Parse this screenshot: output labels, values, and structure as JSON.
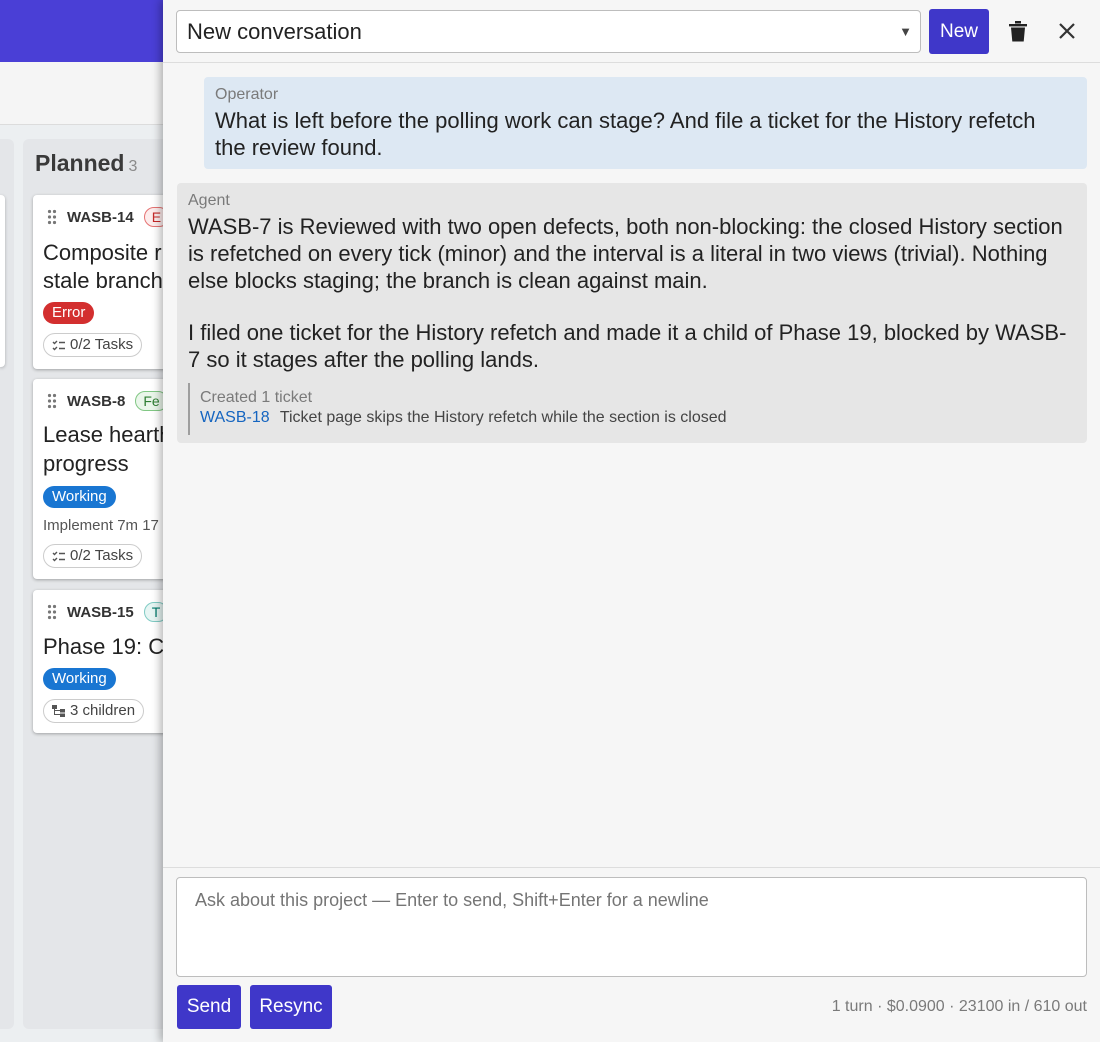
{
  "board": {
    "column": {
      "title": "Planned",
      "count": "3"
    },
    "cards": [
      {
        "id": "WASB-14",
        "tag": "E",
        "title_lines": [
          "Composite r",
          "stale branch"
        ],
        "status": "Error",
        "chip": "0/2 Tasks"
      },
      {
        "id": "WASB-8",
        "tag": "Fe",
        "title_lines": [
          "Lease hearth",
          "progress"
        ],
        "status": "Working",
        "meta": "Implement  7m 17",
        "chip": "0/2 Tasks"
      },
      {
        "id": "WASB-15",
        "tag": "T",
        "title_lines": [
          "Phase 19: Co"
        ],
        "status": "Working",
        "chip": "3 children"
      }
    ]
  },
  "drawer": {
    "conversation_select": "New conversation",
    "new_label": "New",
    "messages": {
      "user": {
        "label": "Operator",
        "text": "What is left before the polling work can stage? And file a ticket for the History refetch the review found."
      },
      "agent": {
        "label": "Agent",
        "paragraph1": "WASB-7 is Reviewed with two open defects, both non-blocking: the closed History section is refetched on every tick (minor) and the interval is a literal in two views (trivial). Nothing else blocks staging; the branch is clean against main.",
        "paragraph2": "I filed one ticket for the History refetch and made it a child of Phase 19, blocked by WASB-7 so it stages after the polling lands.",
        "attachment": {
          "label": "Created 1 ticket",
          "ticket_id": "WASB-18",
          "ticket_title": "Ticket page skips the History refetch while the section is closed"
        }
      }
    },
    "composer": {
      "placeholder": "Ask about this project — Enter to send, Shift+Enter for a newline",
      "send_label": "Send",
      "resync_label": "Resync",
      "usage": "1 turn · $0.0900 · 23100 in / 610 out"
    }
  },
  "colors": {
    "accent": "#3f37c9",
    "topbar": "#4a3fd6",
    "error": "#d32f2f",
    "working": "#1976d2",
    "link": "#1565c0"
  }
}
